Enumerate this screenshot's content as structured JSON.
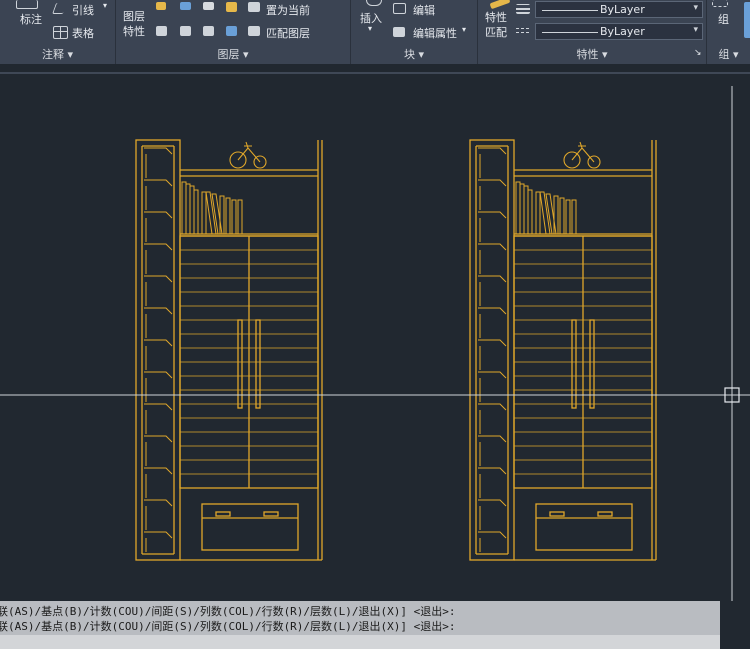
{
  "ribbon": {
    "annotation": {
      "dimension_label": "标注",
      "leader_label": "引线",
      "table_label": "表格",
      "panel_title": "注释"
    },
    "layers": {
      "layer_properties_label": "图层\n特性",
      "set_current_label": "置为当前",
      "match_layer_label": "匹配图层",
      "panel_title": "图层"
    },
    "block": {
      "insert_label": "插入",
      "edit_label": "编辑",
      "edit_attributes_label": "编辑属性",
      "panel_title": "块"
    },
    "properties": {
      "match_properties_label": "特性\n匹配",
      "color_value": "ByLayer",
      "linetype_value": "ByLayer",
      "panel_title": "特性"
    },
    "groups": {
      "group_label": "组",
      "panel_title": "组"
    }
  },
  "command_line": {
    "history": [
      "关联(AS)/基点(B)/计数(COU)/间距(S)/列数(COL)/行数(R)/层数(L)/退出(X)] <退出>:",
      "关联(AS)/基点(B)/计数(COU)/间距(S)/列数(COL)/行数(R)/层数(L)/退出(X)] <退出>:"
    ]
  },
  "colors": {
    "drawing_line": "#e0a72a",
    "crosshair": "#cfd3d8",
    "canvas": "#212830",
    "ribbon": "#3b4453"
  }
}
